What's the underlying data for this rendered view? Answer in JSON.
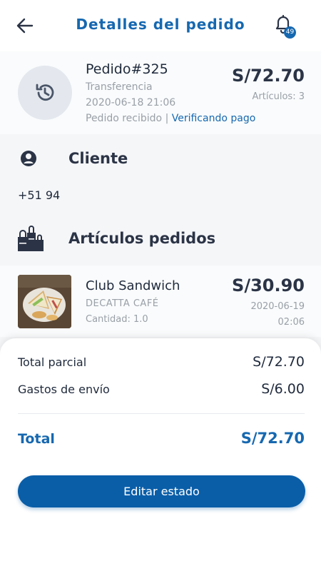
{
  "header": {
    "title": "Detalles del pedido",
    "notification_count": "49"
  },
  "order": {
    "number": "Pedido#325",
    "payment_method": "Transferencia",
    "datetime": "2020-06-18 21:06",
    "status_prefix": "Pedido recibido | ",
    "status_link": "Verificando pago",
    "total": "S/72.70",
    "items_count": "Artículos: 3"
  },
  "client": {
    "title": "Cliente",
    "phone": "+51 94"
  },
  "items_section": {
    "title": "Artículos pedidos"
  },
  "items": [
    {
      "name": "Club Sandwich",
      "brand": "DECATTA CAFÉ",
      "quantity": "Cantidad: 1.0",
      "price": "S/30.90",
      "date": "2020-06-19",
      "time": "02:06"
    }
  ],
  "summary": {
    "subtotal_label": "Total parcial",
    "subtotal_value": "S/72.70",
    "shipping_label": "Gastos de envío",
    "shipping_value": "S/6.00",
    "total_label": "Total",
    "total_value": "S/72.70",
    "edit_button": "Editar estado"
  },
  "colors": {
    "accent": "#1668b0",
    "button": "#0a5ea8",
    "text_dark": "#2b3446",
    "text_muted": "#9aa0a8"
  },
  "icons": {
    "back": "arrow-left-icon",
    "notifications": "bell-icon",
    "order_status": "history-icon",
    "client": "user-circle-icon",
    "items": "shopping-bags-icon"
  }
}
